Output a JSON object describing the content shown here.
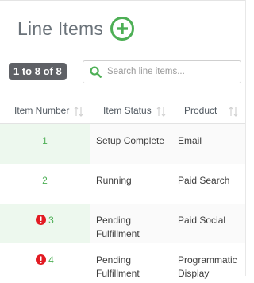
{
  "header": {
    "title": "Line Items"
  },
  "toolbar": {
    "count_badge": "1 to 8 of 8",
    "search_placeholder": "Search line items..."
  },
  "table": {
    "columns": [
      "Item Number",
      "Item Status",
      "Product"
    ],
    "rows": [
      {
        "number": "1",
        "status": "Setup Complete",
        "product": "Email",
        "alert": false
      },
      {
        "number": "2",
        "status": "Running",
        "product": "Paid Search",
        "alert": false
      },
      {
        "number": "3",
        "status": "Pending Fulfillment",
        "product": "Paid Social",
        "alert": true
      },
      {
        "number": "4",
        "status": "Pending Fulfillment",
        "product": "Programmatic Display",
        "alert": true
      }
    ]
  },
  "colors": {
    "accent_green": "#4daf55",
    "alert_red": "#e21b23",
    "badge_bg": "#5f6166",
    "highlight_cell": "#edf8ee"
  },
  "icons": {
    "add": "plus-circle-icon",
    "search": "search-icon",
    "sort": "sort-arrows-icon",
    "alert": "exclamation-circle-icon"
  }
}
